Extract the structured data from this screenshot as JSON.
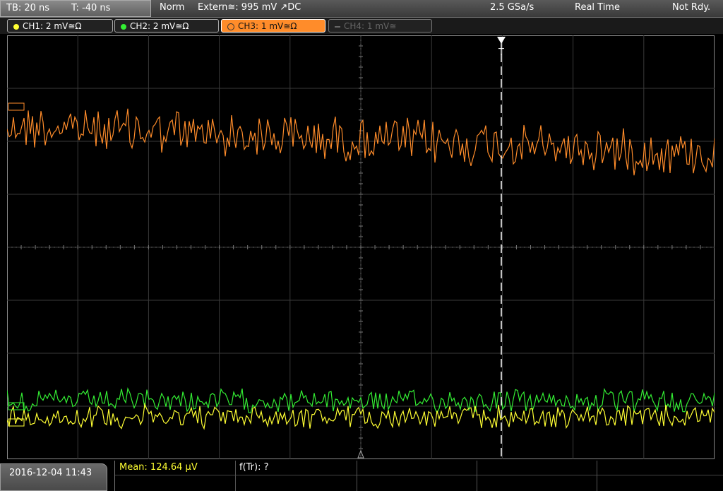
{
  "status": {
    "timebase": "TB: 20 ns",
    "trigger_time": "T: -40 ns",
    "mode": "Norm",
    "trigger_source": "Extern≅: 995 mV ↗DC",
    "sample_rate": "2.5 GSa/s",
    "acq_mode": "Real Time",
    "state": "Not Rdy."
  },
  "channels": [
    {
      "label": "CH1: 2 mV≅Ω",
      "color": "#ffff33",
      "active": false
    },
    {
      "label": "CH2: 2 mV≅Ω",
      "color": "#33ee33",
      "active": false
    },
    {
      "label": "CH3: 1 mV≅Ω",
      "color": "#ff8c2a",
      "active": true
    },
    {
      "label": "CH4: 1 mV≅",
      "color": "#555555",
      "active": false,
      "disabled": true
    }
  ],
  "trigger_marker": "T",
  "footer": {
    "datetime": "2016-12-04 11:43",
    "measure_1": "Mean: 124.64 µV",
    "measure_2": "f(Tr): ?"
  },
  "traces": {
    "ch3_level_div": 2.3,
    "ch2_level_div": -2.9,
    "ch1_level_div": -3.2
  }
}
